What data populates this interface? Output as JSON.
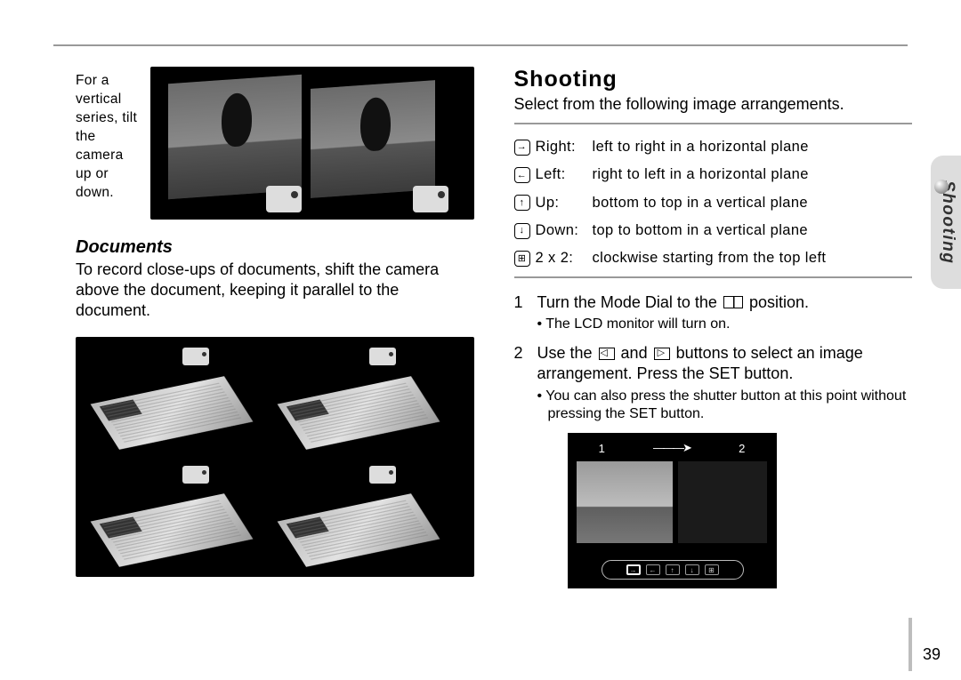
{
  "section_tab": "Shooting",
  "page_number": "39",
  "left": {
    "vertical_note": "For a vertical series, tilt the camera up or down.",
    "documents_heading": "Documents",
    "documents_para": "To record close-ups of documents, shift the camera above the document, keeping it parallel to the document."
  },
  "right": {
    "heading": "Shooting",
    "lead": "Select from the following image arrangements.",
    "arrangements": [
      {
        "icon": "→",
        "key": "Right:",
        "desc": "left to right in a horizontal plane"
      },
      {
        "icon": "←",
        "key": "Left:",
        "desc": "right to left in a horizontal plane"
      },
      {
        "icon": "↑",
        "key": "Up:",
        "desc": "bottom to top in a vertical plane"
      },
      {
        "icon": "↓",
        "key": "Down:",
        "desc": "top to bottom in a vertical plane"
      },
      {
        "icon": "⊞",
        "key": "2 x 2:",
        "desc": "clockwise starting from the top left"
      }
    ],
    "step1_num": "1",
    "step1_a": "Turn the Mode Dial to the ",
    "step1_b": " position.",
    "step1_bullet": "• The LCD monitor will turn on.",
    "step2_num": "2",
    "step2_a": "Use the ",
    "step2_b": " and ",
    "step2_c": " buttons to select an image arrangement. Press the SET button.",
    "step2_bullet": "• You can also press the shutter button at this point without pressing the SET button.",
    "lcd": {
      "left_num": "1",
      "right_num": "2"
    }
  }
}
